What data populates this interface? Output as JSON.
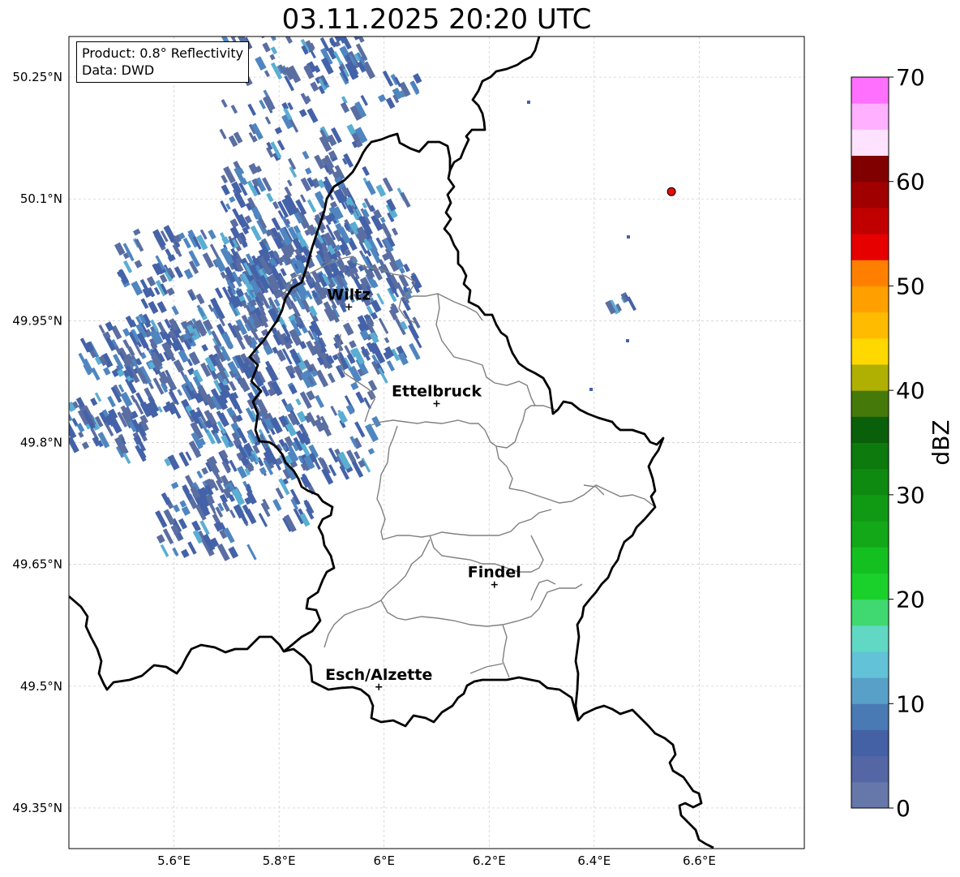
{
  "title": "03.11.2025 20:20 UTC",
  "info": {
    "product": "Product: 0.8° Reflectivity",
    "data": "Data: DWD"
  },
  "axes": {
    "lon_ticks": [
      {
        "value": 5.6,
        "label": "5.6°E"
      },
      {
        "value": 5.8,
        "label": "5.8°E"
      },
      {
        "value": 6.0,
        "label": "6°E"
      },
      {
        "value": 6.2,
        "label": "6.2°E"
      },
      {
        "value": 6.4,
        "label": "6.4°E"
      },
      {
        "value": 6.6,
        "label": "6.6°E"
      }
    ],
    "lat_ticks": [
      {
        "value": 50.25,
        "label": "50.25°N"
      },
      {
        "value": 50.1,
        "label": "50.1°N"
      },
      {
        "value": 49.95,
        "label": "49.95°N"
      },
      {
        "value": 49.8,
        "label": "49.8°N"
      },
      {
        "value": 49.65,
        "label": "49.65°N"
      },
      {
        "value": 49.5,
        "label": "49.5°N"
      },
      {
        "value": 49.35,
        "label": "49.35°N"
      }
    ],
    "lon_range": [
      5.4,
      6.8
    ],
    "lat_range": [
      49.3,
      50.3
    ],
    "grid": true
  },
  "cities": [
    {
      "name": "Wiltz",
      "lon": 5.933,
      "lat": 49.967
    },
    {
      "name": "Ettelbruck",
      "lon": 6.1,
      "lat": 49.848
    },
    {
      "name": "Findel",
      "lon": 6.21,
      "lat": 49.625
    },
    {
      "name": "Esch/Alzette",
      "lon": 5.99,
      "lat": 49.499
    }
  ],
  "radar_site": {
    "lon": 6.547,
    "lat": 50.109,
    "color": "#e01010"
  },
  "colorbar": {
    "label": "dBZ",
    "min": 0,
    "max": 70,
    "step": 2.5,
    "tick_labels": [
      "0",
      "10",
      "20",
      "30",
      "40",
      "50",
      "60",
      "70"
    ],
    "colors": [
      "#6677aa",
      "#5566a4",
      "#4461a6",
      "#4a7ab4",
      "#58a0c8",
      "#62c2d8",
      "#60d8c4",
      "#40d870",
      "#1ad02a",
      "#14c020",
      "#12a818",
      "#109a14",
      "#0f8a10",
      "#0c7a0c",
      "#0a600a",
      "#457a0a",
      "#b0b002",
      "#ffd800",
      "#ffbb00",
      "#ffa000",
      "#ff8000",
      "#e60000",
      "#c00000",
      "#a00000",
      "#800000",
      "#ffe2ff",
      "#ffb0ff",
      "#ff70ff",
      "#e635f0"
    ]
  },
  "colors": {
    "border": "#000000",
    "cantons": "#808080",
    "grid": "#c8c8c8",
    "rain_dark": "#5a6ea2",
    "rain_mid": "#4462a8",
    "rain_light": "#4f86c0",
    "rain_cyan": "#5aaed2"
  }
}
